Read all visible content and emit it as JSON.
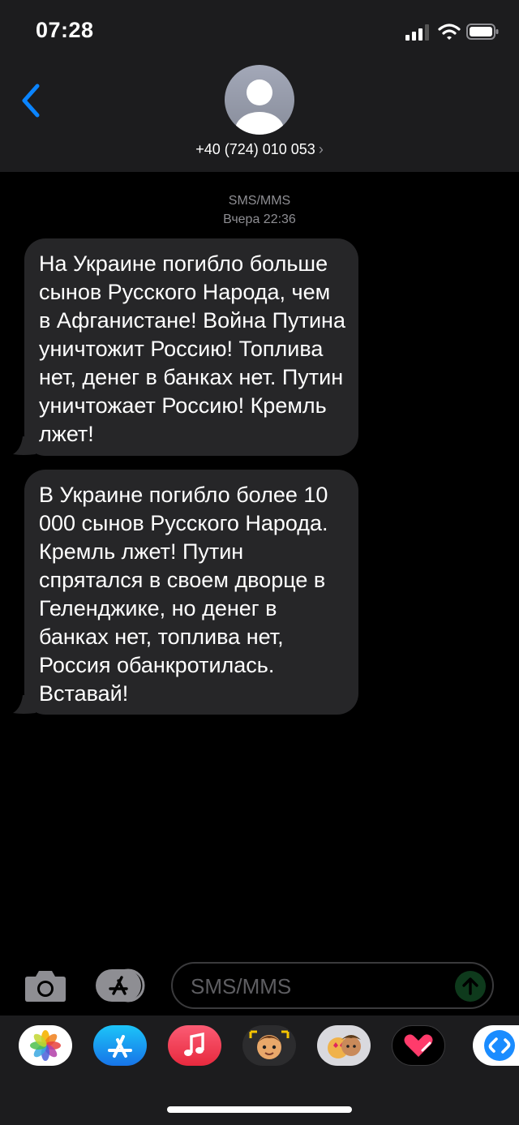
{
  "status": {
    "time": "07:28"
  },
  "header": {
    "contact": "+40 (724) 010 053",
    "contact_chevron": "›"
  },
  "conversation": {
    "service": "SMS/MMS",
    "timestamp": "Вчера 22:36",
    "messages": [
      {
        "text": "На Украине погибло больше сынов Русского Народа, чем в Афганистане! Война Путина уничтожит Россию! Топлива нет, денег в банках нет. Путин уничтожает Россию! Кремль лжет!"
      },
      {
        "text": "В Украине погибло более 10 000 сынов Русского Народа. Кремль лжет! Путин спрятался в своем дворце в Геленджике, но денег в банках нет, топлива нет, Россия обанкротилась. Вставай!"
      }
    ]
  },
  "composer": {
    "placeholder": "SMS/MMS"
  },
  "colors": {
    "accent": "#0a84ff",
    "bubble": "#262628",
    "bar": "#1c1c1e",
    "send": "#0e3a1c"
  },
  "app_drawer": [
    "photos-icon",
    "app-store-icon",
    "music-icon",
    "memoji-icon",
    "animoji-icon",
    "digital-touch-icon",
    "shazam-icon"
  ]
}
